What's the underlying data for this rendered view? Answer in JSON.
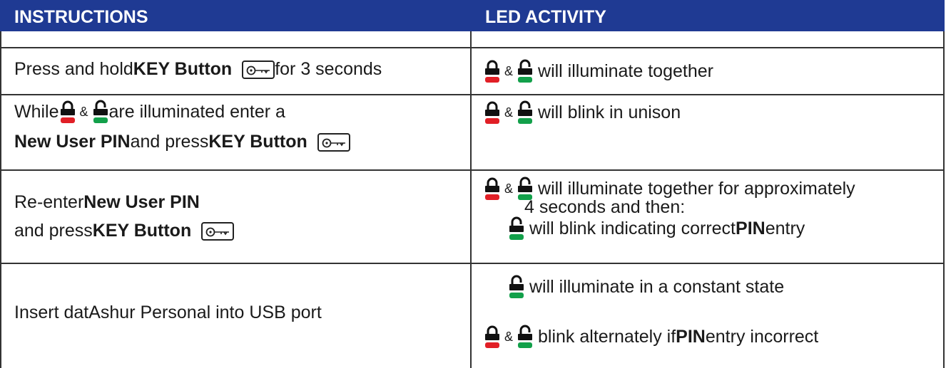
{
  "header": {
    "instructions": "INSTRUCTIONS",
    "led_activity": "LED ACTIVITY"
  },
  "colors": {
    "header_bg": "#1f3a93",
    "red_led": "#e11f26",
    "green_led": "#12a04a"
  },
  "rows": [
    {
      "instruction": {
        "line1": {
          "t1": "Press and hold ",
          "b1": "KEY Button",
          "t2": " for 3 seconds"
        }
      },
      "led": {
        "line1": {
          "amp": "&",
          "t1": " will illuminate together"
        }
      }
    },
    {
      "instruction": {
        "line1": {
          "t1": "While ",
          "amp": "&",
          "t2": " are illuminated enter a"
        },
        "line2": {
          "b1": "New User PIN",
          "t1": " and press ",
          "b2": "KEY Button"
        }
      },
      "led": {
        "line1": {
          "amp": "&",
          "t1": " will blink in unison"
        }
      }
    },
    {
      "instruction": {
        "line1": {
          "t1": "Re-enter ",
          "b1": "New User PIN"
        },
        "line2": {
          "t1": "and press ",
          "b1": "KEY Button"
        }
      },
      "led": {
        "line1": {
          "amp": "&",
          "t1": " will illuminate together for approximately"
        },
        "line2": {
          "t1": "4 seconds and then:"
        },
        "line3": {
          "t1": " will blink indicating correct ",
          "b1": "PIN",
          "t2": " entry"
        }
      }
    },
    {
      "instruction": {
        "line1": {
          "t1": "Insert datAshur Personal into USB port"
        }
      },
      "led": {
        "line1": {
          "t1": " will illuminate in a constant state"
        },
        "line2": {
          "amp": "&",
          "t1": " blink alternately if ",
          "b1": "PIN",
          "t2": " entry incorrect"
        }
      }
    }
  ],
  "icons": {
    "key_button": "key-button-icon",
    "red_lock": "red-locked-led-icon",
    "green_lock": "green-unlocked-led-icon"
  }
}
